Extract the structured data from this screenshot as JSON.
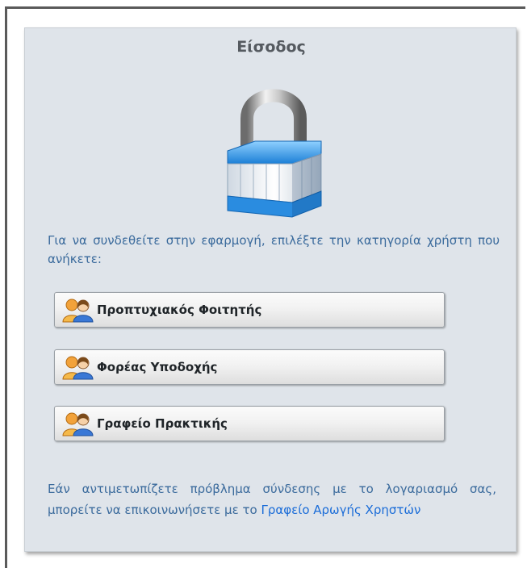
{
  "login": {
    "title": "Είσοδος",
    "intro": "Για να συνδεθείτε στην εφαρμογή, επιλέξτε την κατηγορία χρήστη που ανήκετε:",
    "buttons": [
      {
        "label": "Προπτυχιακός Φοιτητής",
        "icon": "users-icon"
      },
      {
        "label": "Φορέας Υποδοχής",
        "icon": "users-icon"
      },
      {
        "label": "Γραφείο Πρακτικής",
        "icon": "users-icon"
      }
    ],
    "footer_text": "Εάν αντιμετωπίζετε πρόβλημα σύνδεσης με το λογαριασμό σας, μπορείτε να επικοινωνήσετε με το",
    "footer_link": "Γραφείο Αρωγής Χρηστών",
    "lock_icon": "padlock-icon"
  }
}
